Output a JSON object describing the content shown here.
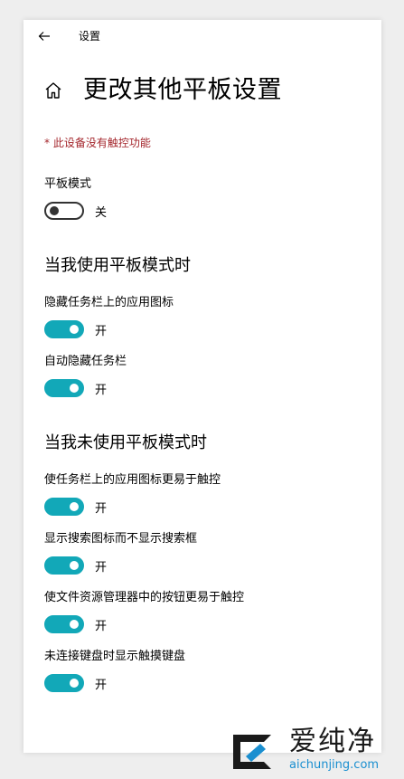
{
  "window": {
    "app_title": "设置",
    "page_title": "更改其他平板设置"
  },
  "warning": "* 此设备没有触控功能",
  "tablet_mode": {
    "label": "平板模式",
    "state": "关",
    "on": false
  },
  "sections": [
    {
      "title": "当我使用平板模式时",
      "settings": [
        {
          "label": "隐藏任务栏上的应用图标",
          "state": "开",
          "on": true
        },
        {
          "label": "自动隐藏任务栏",
          "state": "开",
          "on": true
        }
      ]
    },
    {
      "title": "当我未使用平板模式时",
      "settings": [
        {
          "label": "使任务栏上的应用图标更易于触控",
          "state": "开",
          "on": true
        },
        {
          "label": "显示搜索图标而不显示搜索框",
          "state": "开",
          "on": true
        },
        {
          "label": "使文件资源管理器中的按钮更易于触控",
          "state": "开",
          "on": true
        },
        {
          "label": "未连接键盘时显示触摸键盘",
          "state": "开",
          "on": true
        }
      ]
    }
  ],
  "watermark": {
    "brand": "爱纯净",
    "url": "aichunjing.com"
  },
  "colors": {
    "accent": "#12a8b8",
    "warning": "#a4262c",
    "watermark_url": "#1a8fd0"
  },
  "icons": {
    "back": "back-arrow-icon",
    "home": "home-icon"
  }
}
